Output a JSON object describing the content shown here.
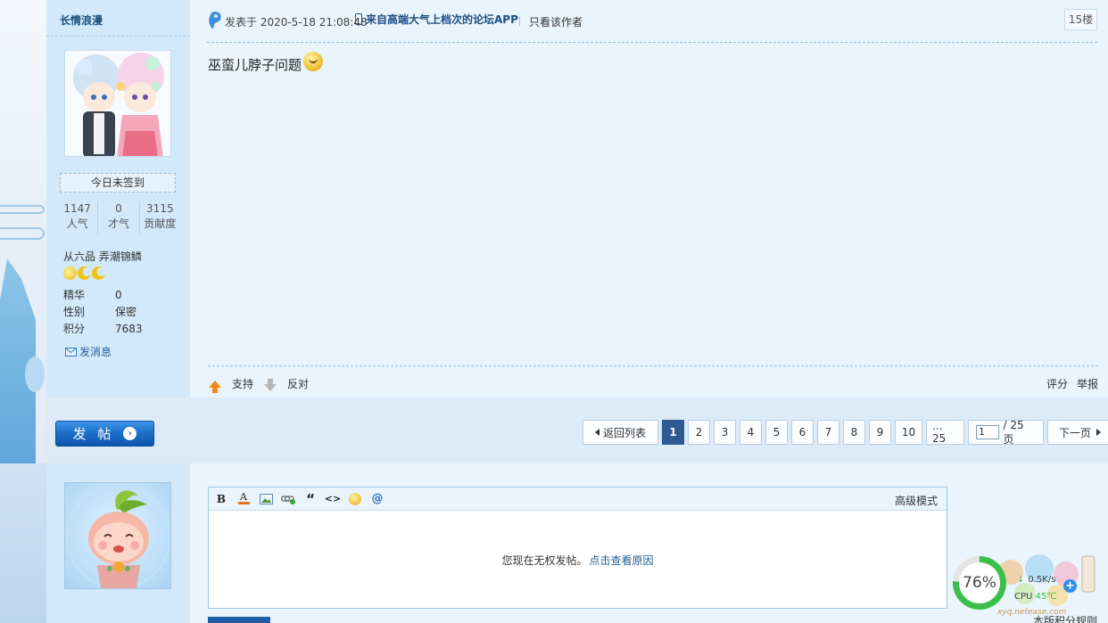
{
  "author": {
    "name": "长情浪漫",
    "signin": "今日未签到",
    "stats": [
      {
        "value": "1147",
        "label": "人气"
      },
      {
        "value": "0",
        "label": "才气"
      },
      {
        "value": "3115",
        "label": "贡献度"
      }
    ],
    "rank": "从六品 弄潮锦鳞",
    "info": [
      {
        "key": "精华",
        "value": "0"
      },
      {
        "key": "性别",
        "value": "保密"
      },
      {
        "key": "积分",
        "value": "7683"
      }
    ],
    "send_message": "发消息"
  },
  "post": {
    "posted_at": "发表于 2020-5-18 21:08:48",
    "from_app": "来自高端大气上档次的论坛APP",
    "only_author": "只看该作者",
    "floor": "15楼",
    "body": "巫蛮儿脖子问题",
    "support": "支持",
    "oppose": "反对",
    "rate": "评分",
    "report": "举报"
  },
  "new_post_button": "发 帖",
  "pager": {
    "back": "返回列表",
    "pages": [
      "1",
      "2",
      "3",
      "4",
      "5",
      "6",
      "7",
      "8",
      "9",
      "10",
      "... 25"
    ],
    "current": "1",
    "jump_value": "1",
    "total": "/ 25 页",
    "next": "下一页"
  },
  "editor": {
    "advanced_mode": "高级模式",
    "no_permission": "您现在无权发帖。",
    "see_reason": "点击查看原因",
    "tools": [
      "bold-icon",
      "font-color-icon",
      "image-icon",
      "link-icon",
      "quote-icon",
      "code-icon",
      "emoticon-icon",
      "mention-icon"
    ]
  },
  "rules": "本版积分规则",
  "widget": {
    "percent": "76%",
    "net_speed": "0.5K/s",
    "cpu_label": "CPU",
    "cpu_temp": "45℃",
    "site": "xyq.netease.com"
  }
}
